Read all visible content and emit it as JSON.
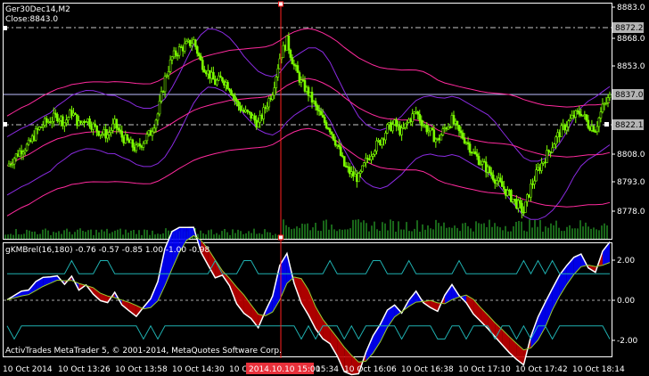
{
  "main_chart": {
    "symbol_line": "Ger30Dec14,M2",
    "close_line": "Close:8843.0",
    "price_ticks": [
      "8883.0",
      "8868.0",
      "8853.0",
      "8837.0",
      "8822.1",
      "8808.0",
      "8793.0",
      "8778.0"
    ],
    "price_boxes": [
      {
        "label": "8872.2",
        "bg": "#b4b4b4"
      },
      {
        "label": "8837.0",
        "bg": "#b4b4b4"
      },
      {
        "label": "8822.1",
        "bg": "#b4b4b4"
      }
    ]
  },
  "indicator": {
    "title": "gKMBrel(16,180) -0.76 -0.57 -0.85 1.00 -1.00 -0.98",
    "ticks": [
      "2.00",
      "0.00",
      "-2.00"
    ]
  },
  "watermark": "ActivTrades MetaTrader 5, © 2001-2014, MetaQuotes Software Corp.",
  "time_axis": {
    "labels": [
      "10 Oct 2014",
      "10 Oct 13:26",
      "10 Oct 13:58",
      "10 Oct 14:30",
      "10 Oct 1",
      "15:34",
      "10 Oct 16:06",
      "10 Oct 16:38",
      "10 Oct 17:10",
      "10 Oct 17:42",
      "10 Oct 18:14"
    ],
    "cursor_label": "2014.10.10 15:00"
  },
  "colors": {
    "candle": "#7cfc00",
    "bb_outer": "#ff2a9d",
    "bb_inner": "#8a2be2",
    "cursor": "#ff2020",
    "ind_blue": "#0000ff",
    "ind_red": "#c00000",
    "ind_white": "#ffffff",
    "ind_green": "#9acd32",
    "ind_cyan": "#1fb0b0",
    "volume": "#32cd32"
  },
  "chart_data": {
    "type": "candlestick",
    "price_close_series": [
      8810,
      8814,
      8818,
      8820,
      8826,
      8830,
      8832,
      8834,
      8831,
      8836,
      8830,
      8833,
      8829,
      8826,
      8825,
      8830,
      8824,
      8821,
      8818,
      8822,
      8826,
      8835,
      8852,
      8862,
      8866,
      8868,
      8870,
      8860,
      8855,
      8850,
      8852,
      8848,
      8840,
      8836,
      8834,
      8830,
      8838,
      8846,
      8862,
      8870,
      8858,
      8850,
      8845,
      8838,
      8832,
      8828,
      8820,
      8810,
      8806,
      8804,
      8812,
      8818,
      8822,
      8828,
      8830,
      8826,
      8832,
      8836,
      8830,
      8826,
      8822,
      8828,
      8832,
      8826,
      8822,
      8816,
      8812,
      8808,
      8804,
      8800,
      8796,
      8792,
      8788,
      8800,
      8808,
      8814,
      8820,
      8826,
      8830,
      8834,
      8836,
      8830,
      8828,
      8838,
      8843
    ],
    "price_ylim": [
      8775,
      8888
    ],
    "indicator_ylim": [
      -2.6,
      2.6
    ]
  }
}
